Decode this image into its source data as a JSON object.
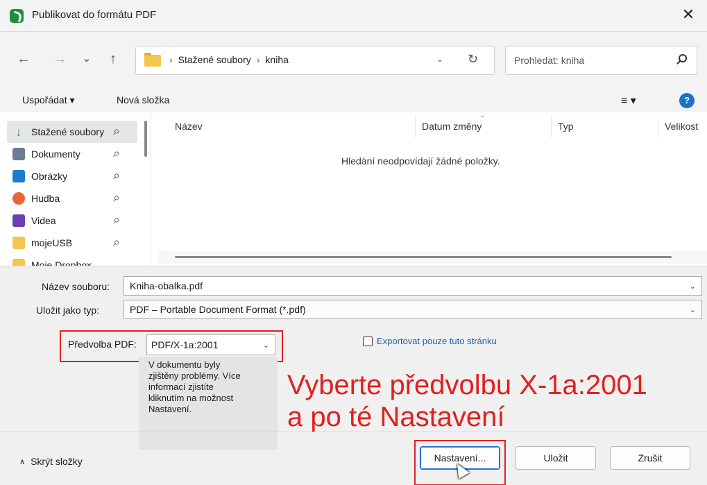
{
  "window": {
    "title": "Publikovat do formátu PDF",
    "close_glyph": "✕"
  },
  "nav": {
    "back": "←",
    "forward": "→",
    "recent": "⌄",
    "up": "↑",
    "breadcrumbs": [
      "Stažené soubory",
      "kniha"
    ],
    "crumb_sep": "›",
    "dropdown_glyph": "⌄",
    "refresh_glyph": "↻",
    "search_placeholder": "Prohledat: kniha"
  },
  "toolbar": {
    "organize": "Uspořádat ▾",
    "new_folder": "Nová složka",
    "view_glyph": "≡ ▾",
    "help": "?"
  },
  "sidebar": {
    "items": [
      {
        "label": "Stažené soubory",
        "icon": "download-icon",
        "color": "#2a9d3a",
        "selected": true
      },
      {
        "label": "Dokumenty",
        "icon": "document-icon",
        "color": "#6b7c93",
        "selected": false
      },
      {
        "label": "Obrázky",
        "icon": "pictures-icon",
        "color": "#1f7ad1",
        "selected": false
      },
      {
        "label": "Hudba",
        "icon": "music-icon",
        "color": "#e8663a",
        "selected": false
      },
      {
        "label": "Videa",
        "icon": "video-icon",
        "color": "#6a3fb5",
        "selected": false
      },
      {
        "label": "mojeUSB",
        "icon": "folder-icon",
        "color": "#f5c64d",
        "selected": false
      },
      {
        "label": "Moje Dropbox",
        "icon": "folder-icon",
        "color": "#f5c64d",
        "selected": false
      }
    ],
    "pin_glyph": "📌"
  },
  "filelist": {
    "columns": [
      "Název",
      "Datum změny",
      "Typ",
      "Velikost"
    ],
    "empty_message": "Hledání neodpovídají žádné položky."
  },
  "form": {
    "filename_label": "Název souboru:",
    "filename_value": "Kniha-obalka.pdf",
    "type_label": "Uložit jako typ:",
    "type_value": "PDF – Portable Document Format (*.pdf)",
    "preset_label": "Předvolba PDF:",
    "preset_value": "PDF/X-1a:2001",
    "note_lines": [
      "V dokumentu byly",
      "zjištěny problémy. Více",
      "informací zjistíte",
      "kliknutím na možnost",
      "Nastavení."
    ],
    "export_page_label": "Exportovat pouze tuto stránku"
  },
  "annotation": {
    "lines": [
      "Vyberte předvolbu X-1a:2001",
      "a po té Nastavení"
    ],
    "color": "#e02020"
  },
  "footer": {
    "hide_folders": "Skrýt složky",
    "settings_button": "Nastavení...",
    "save_button": "Uložit",
    "cancel_button": "Zrušit"
  }
}
